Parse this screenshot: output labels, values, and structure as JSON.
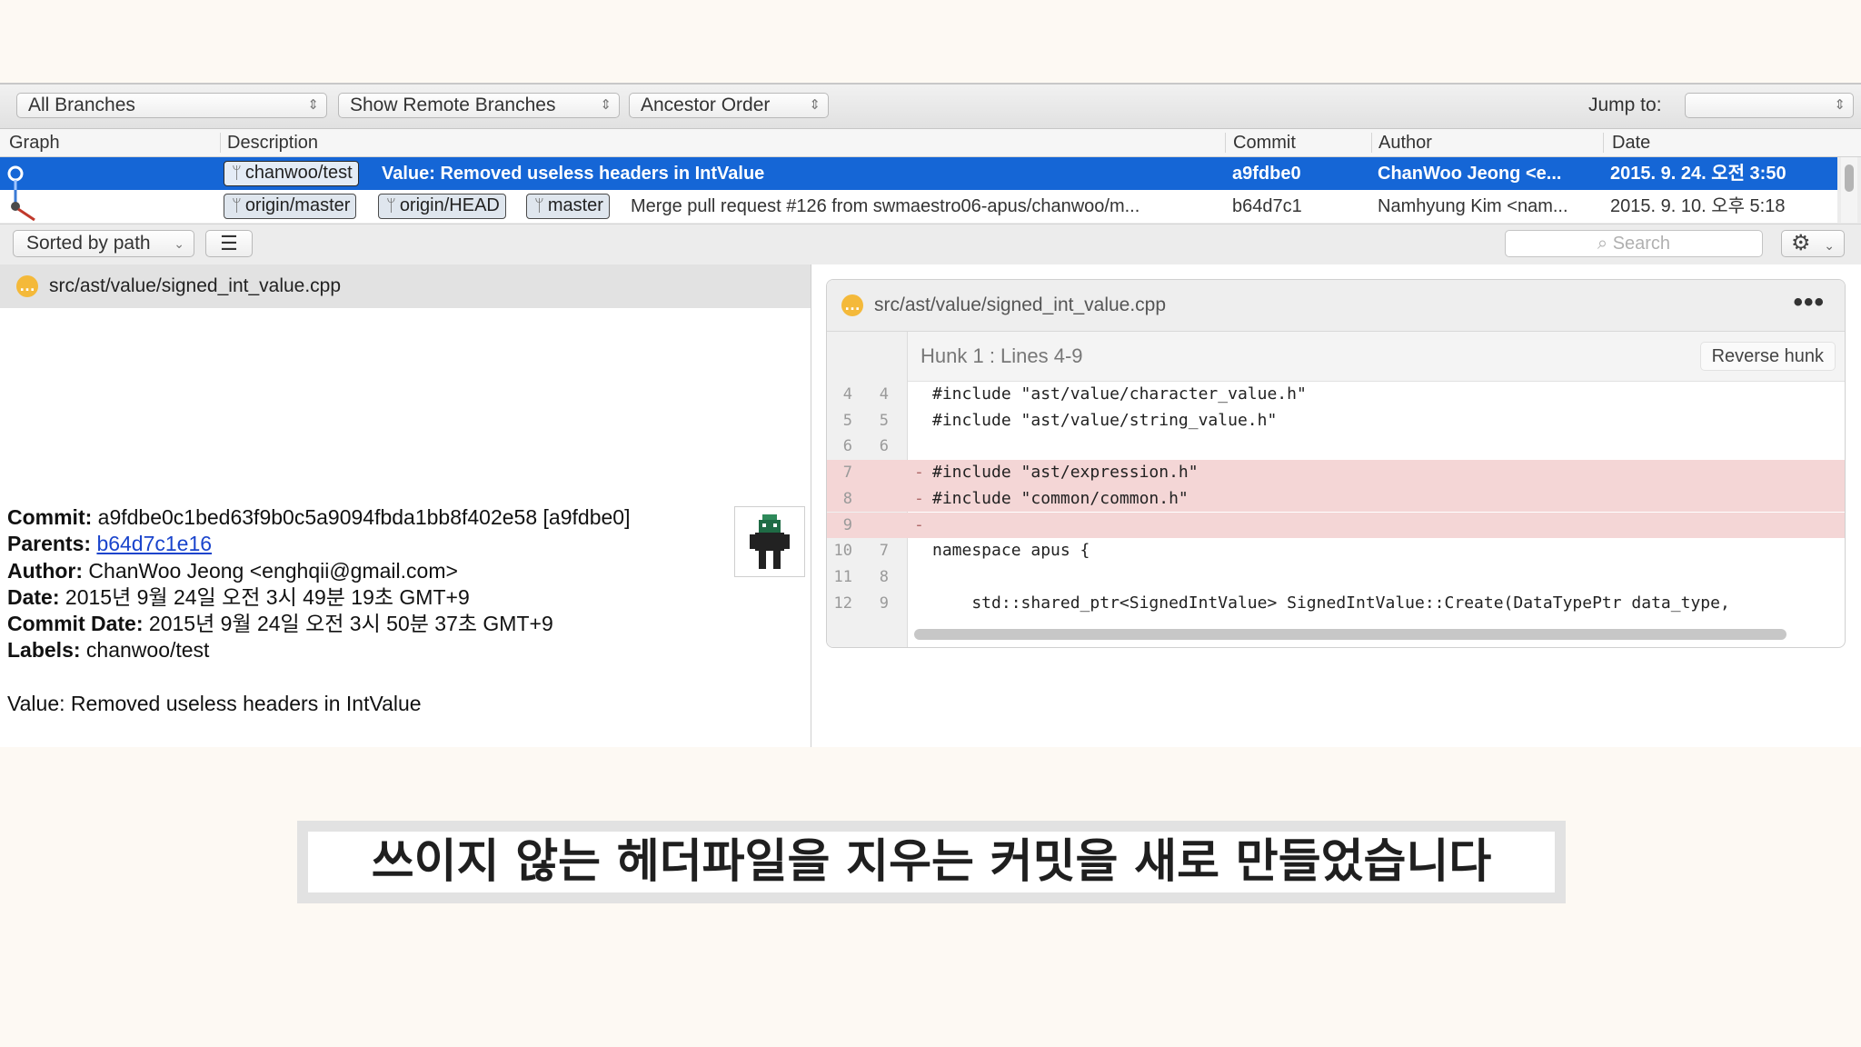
{
  "toolbar": {
    "branch_filter": "All Branches",
    "remote_filter": "Show Remote Branches",
    "order": "Ancestor Order",
    "jump_label": "Jump to:",
    "jump_value": ""
  },
  "columns": {
    "graph": "Graph",
    "description": "Description",
    "commit": "Commit",
    "author": "Author",
    "date": "Date"
  },
  "commits": [
    {
      "labels": [
        "chanwoo/test"
      ],
      "description": "Value: Removed useless headers in IntValue",
      "hash": "a9fdbe0",
      "author": "ChanWoo Jeong <e...",
      "date": "2015. 9. 24. 오전 3:50"
    },
    {
      "labels": [
        "origin/master",
        "origin/HEAD",
        "master"
      ],
      "description": "Merge pull request #126 from swmaestro06-apus/chanwoo/m...",
      "hash": "b64d7c1",
      "author": "Namhyung Kim <nam...",
      "date": "2015. 9. 10. 오후 5:18"
    }
  ],
  "subtoolbar": {
    "sort": "Sorted by path",
    "search_placeholder": "Search"
  },
  "file_list": {
    "path": "src/ast/value/signed_int_value.cpp",
    "status_glyph": "…"
  },
  "commit_info": {
    "commit_label": "Commit:",
    "commit_value": " a9fdbe0c1bed63f9b0c5a9094fbda1bb8f402e58 [a9fdbe0]",
    "parents_label": "Parents:",
    "parents_value": "b64d7c1e16",
    "author_label": "Author:",
    "author_value": " ChanWoo Jeong <enghqii@gmail.com>",
    "date_label": "Date:",
    "date_value": " 2015년 9월 24일 오전 3시 49분 19초 GMT+9",
    "commit_date_label": "Commit Date:",
    "commit_date_value": " 2015년 9월 24일 오전 3시 50분 37초 GMT+9",
    "labels_label": "Labels:",
    "labels_value": " chanwoo/test",
    "message": "Value: Removed useless headers in IntValue"
  },
  "diff": {
    "file": "src/ast/value/signed_int_value.cpp",
    "more": "•••",
    "hunk_title": "Hunk 1 : Lines 4-9",
    "reverse_label": "Reverse hunk",
    "lines": [
      {
        "old": "4",
        "new": "4",
        "type": "ctx",
        "sign": "",
        "text": "#include \"ast/value/character_value.h\""
      },
      {
        "old": "5",
        "new": "5",
        "type": "ctx",
        "sign": "",
        "text": "#include \"ast/value/string_value.h\""
      },
      {
        "old": "6",
        "new": "6",
        "type": "ctx",
        "sign": "",
        "text": ""
      },
      {
        "old": "7",
        "new": "",
        "type": "del",
        "sign": "-",
        "text": "#include \"ast/expression.h\""
      },
      {
        "old": "8",
        "new": "",
        "type": "del",
        "sign": "-",
        "text": "#include \"common/common.h\""
      },
      {
        "old": "9",
        "new": "",
        "type": "del",
        "sign": "-",
        "text": ""
      },
      {
        "old": "10",
        "new": "7",
        "type": "ctx",
        "sign": "",
        "text": "namespace apus {"
      },
      {
        "old": "11",
        "new": "8",
        "type": "ctx",
        "sign": "",
        "text": ""
      },
      {
        "old": "12",
        "new": "9",
        "type": "ctx",
        "sign": "",
        "text": "    std::shared_ptr<SignedIntValue> SignedIntValue::Create(DataTypePtr data_type,"
      }
    ]
  },
  "caption": "쓰이지 않는 헤더파일을 지우는 커밋을 새로 만들었습니다",
  "colors": {
    "selection": "#1566d6",
    "deleted_line": "#f4d6d6",
    "status_dot": "#f4b93a",
    "link": "#1a44cc"
  }
}
